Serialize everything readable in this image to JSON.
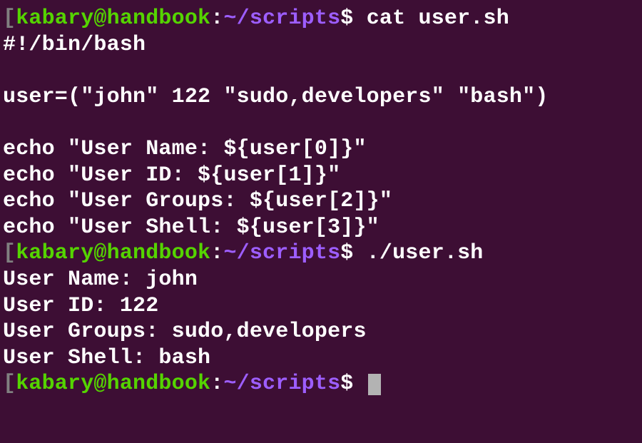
{
  "prompt": {
    "bracket": "[",
    "user_host": "kabary@handbook",
    "colon": ":",
    "path": "~/scripts",
    "dollar": "$ "
  },
  "commands": {
    "cat": "cat user.sh",
    "run": "./user.sh",
    "empty": ""
  },
  "file_content": {
    "l1": "#!/bin/bash",
    "l2": "",
    "l3": "user=(\"john\" 122 \"sudo,developers\" \"bash\")",
    "l4": "",
    "l5": "echo \"User Name: ${user[0]}\"",
    "l6": "echo \"User ID: ${user[1]}\"",
    "l7": "echo \"User Groups: ${user[2]}\"",
    "l8": "echo \"User Shell: ${user[3]}\""
  },
  "output": {
    "l1": "User Name: john",
    "l2": "User ID: 122",
    "l3": "User Groups: sudo,developers",
    "l4": "User Shell: bash"
  }
}
